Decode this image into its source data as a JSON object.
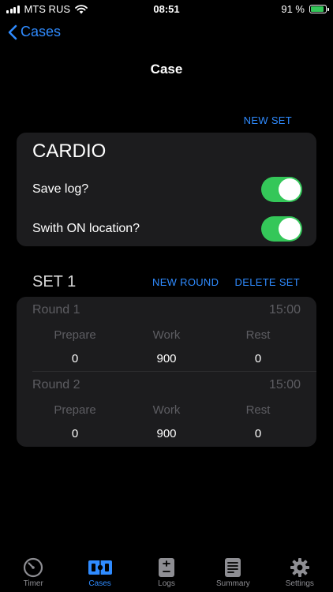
{
  "status_bar": {
    "carrier": "MTS RUS",
    "time": "08:51",
    "battery_text": "91 %",
    "battery_level": 0.91
  },
  "nav": {
    "back_label": "Cases",
    "title": "Case"
  },
  "toolbar": {
    "new_set_label": "NEW SET"
  },
  "case": {
    "name": "CARDIO",
    "save_log_label": "Save log?",
    "save_log_on": true,
    "location_label": "Swith ON location?",
    "location_on": true
  },
  "set": {
    "title": "SET 1",
    "new_round_label": "NEW ROUND",
    "delete_set_label": "DELETE SET",
    "rounds": [
      {
        "name": "Round 1",
        "total": "15:00",
        "prepare_label": "Prepare",
        "work_label": "Work",
        "rest_label": "Rest",
        "prepare": "0",
        "work": "900",
        "rest": "0"
      },
      {
        "name": "Round 2",
        "total": "15:00",
        "prepare_label": "Prepare",
        "work_label": "Work",
        "rest_label": "Rest",
        "prepare": "0",
        "work": "900",
        "rest": "0"
      }
    ]
  },
  "tabs": [
    {
      "label": "Timer",
      "icon": "timer-icon",
      "active": false
    },
    {
      "label": "Cases",
      "icon": "cases-icon",
      "active": true
    },
    {
      "label": "Logs",
      "icon": "logs-icon",
      "active": false
    },
    {
      "label": "Summary",
      "icon": "summary-icon",
      "active": false
    },
    {
      "label": "Settings",
      "icon": "gear-icon",
      "active": false
    }
  ],
  "colors": {
    "accent": "#2f8bff",
    "toggle_on": "#34c759",
    "card_bg": "#1c1c1e",
    "muted_text": "#5d5d62"
  }
}
